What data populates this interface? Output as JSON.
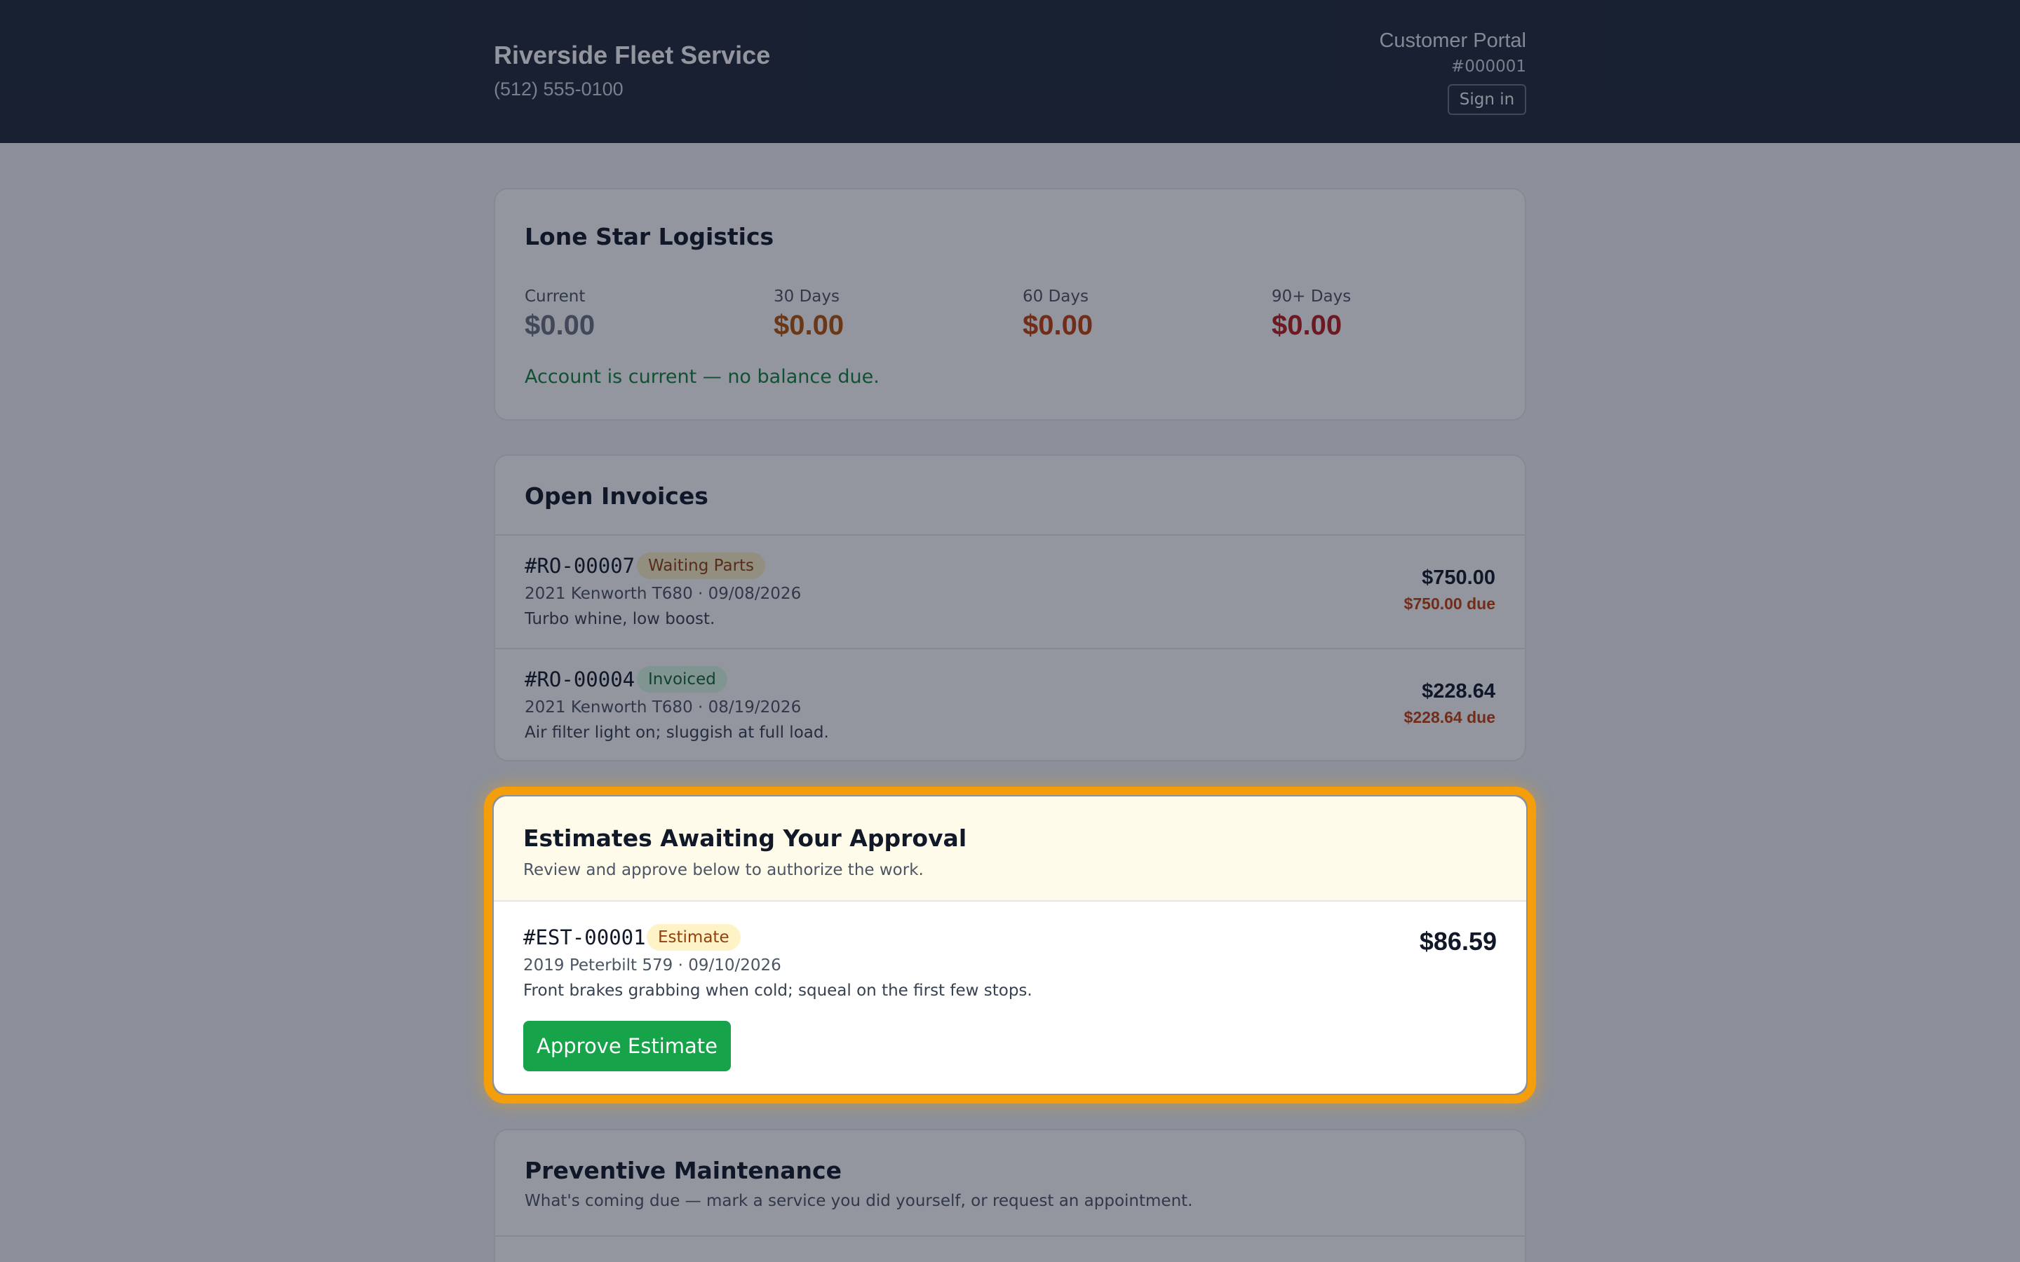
{
  "header": {
    "shop_name": "Riverside Fleet Service",
    "phone": "(512) 555-0100",
    "portal_label": "Customer Portal",
    "portal_id": "#000001",
    "signin_label": "Sign in"
  },
  "account": {
    "customer_name": "Lone Star Logistics",
    "aging": [
      {
        "label": "Current",
        "value": "$0.00",
        "color": "#6b7280"
      },
      {
        "label": "30 Days",
        "value": "$0.00",
        "color": "#b45309"
      },
      {
        "label": "60 Days",
        "value": "$0.00",
        "color": "#c2410c"
      },
      {
        "label": "90+ Days",
        "value": "$0.00",
        "color": "#b91c1c"
      }
    ],
    "status_message": "Account is current — no balance due."
  },
  "open_invoices": {
    "title": "Open Invoices",
    "items": [
      {
        "id": "#RO-00007",
        "status": "Waiting Parts",
        "status_bg": "#fef3c7",
        "status_color": "#92400e",
        "meta": "2021 Kenworth T680 · 09/08/2026",
        "note": "Turbo whine, low boost.",
        "amount": "$750.00",
        "due": "$750.00 due"
      },
      {
        "id": "#RO-00004",
        "status": "Invoiced",
        "status_bg": "#dcfce7",
        "status_color": "#166534",
        "meta": "2021 Kenworth T680 · 08/19/2026",
        "note": "Air filter light on; sluggish at full load.",
        "amount": "$228.64",
        "due": "$228.64 due"
      }
    ]
  },
  "estimates": {
    "title": "Estimates Awaiting Your Approval",
    "subtitle": "Review and approve below to authorize the work.",
    "items": [
      {
        "id": "#EST-00001",
        "status": "Estimate",
        "meta": "2019 Peterbilt 579 · 09/10/2026",
        "note": "Front brakes grabbing when cold; squeal on the first few stops.",
        "amount": "$86.59",
        "approve_label": "Approve Estimate"
      }
    ]
  },
  "maintenance": {
    "title": "Preventive Maintenance",
    "subtitle": "What's coming due — mark a service you did yourself, or request an appointment."
  }
}
